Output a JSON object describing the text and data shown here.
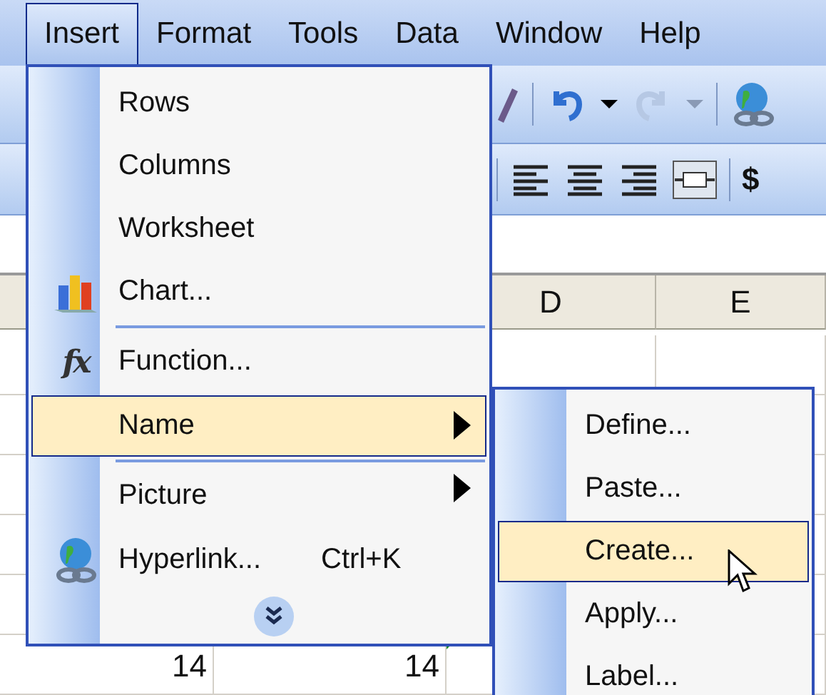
{
  "menu_bar": [
    {
      "label": "Insert",
      "selected": true
    },
    {
      "label": "Format",
      "selected": false
    },
    {
      "label": "Tools",
      "selected": false
    },
    {
      "label": "Data",
      "selected": false
    },
    {
      "label": "Window",
      "selected": false
    },
    {
      "label": "Help",
      "selected": false
    }
  ],
  "toolbar": {
    "currency_label": "$"
  },
  "sheet": {
    "column_headers": [
      "D",
      "E"
    ],
    "cells": [
      {
        "text": "14",
        "error_marker": false
      },
      {
        "text": "14",
        "error_marker": true
      }
    ]
  },
  "insert_menu": {
    "items": [
      {
        "label": "Rows",
        "kind": "plain",
        "separator_before": false,
        "has_submenu": false,
        "selected": false
      },
      {
        "label": "Columns",
        "kind": "plain",
        "separator_before": false,
        "has_submenu": false,
        "selected": false
      },
      {
        "label": "Worksheet",
        "kind": "plain",
        "separator_before": false,
        "has_submenu": false,
        "selected": false
      },
      {
        "label": "Chart...",
        "kind": "chart",
        "separator_before": false,
        "has_submenu": false,
        "selected": false
      },
      {
        "label": "Function...",
        "kind": "function",
        "icon_glyph": "fx",
        "separator_before": true,
        "has_submenu": false,
        "selected": false
      },
      {
        "label": "Name",
        "kind": "plain",
        "separator_before": false,
        "has_submenu": true,
        "selected": true
      },
      {
        "label": "Picture",
        "kind": "plain",
        "separator_before": true,
        "has_submenu": true,
        "selected": false
      },
      {
        "label": "Hyperlink...",
        "kind": "hyperlink",
        "separator_before": false,
        "has_submenu": false,
        "selected": false,
        "shortcut": "Ctrl+K"
      }
    ],
    "expand_button": true
  },
  "name_submenu": {
    "items": [
      {
        "label": "Define...",
        "selected": false
      },
      {
        "label": "Paste...",
        "selected": false
      },
      {
        "label": "Create...",
        "selected": true
      },
      {
        "label": "Apply...",
        "selected": false
      },
      {
        "label": "Label...",
        "selected": false
      }
    ]
  }
}
